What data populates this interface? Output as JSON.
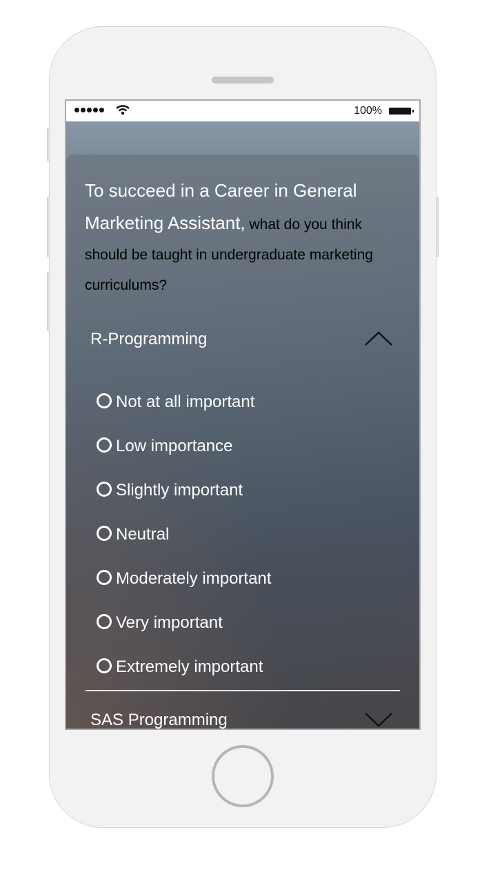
{
  "status_bar": {
    "battery_text": "100%",
    "signal_icon": "signal-dots-icon",
    "wifi_icon": "wifi-icon",
    "battery_icon": "battery-icon"
  },
  "question": {
    "main": "To succeed in a Career in General Marketing Assistant,",
    "rest": " what do you think should be taught in undergraduate marketing curriculums?"
  },
  "sections": [
    {
      "title": "R-Programming",
      "state": "expanded",
      "chevron_icon": "chevron-up-icon",
      "options": [
        "Not at all important",
        "Low importance",
        "Slightly important",
        "Neutral",
        "Moderately important",
        "Very important",
        "Extremely important"
      ]
    },
    {
      "title": "SAS Programming",
      "state": "collapsed",
      "chevron_icon": "chevron-down-icon"
    }
  ],
  "colors": {
    "text_light": "#ffffff",
    "phone_body": "#f2f2f2",
    "screen_top": "#8d9dab",
    "screen_bottom": "#3e434b"
  }
}
